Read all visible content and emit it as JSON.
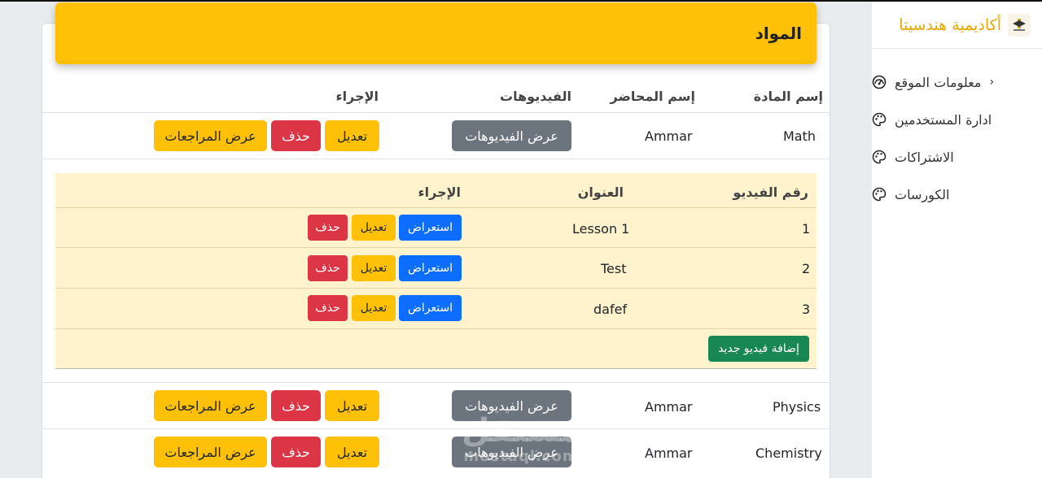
{
  "sidebar": {
    "brand": "أكاديمية هندسيتا",
    "items": [
      {
        "label": "معلومات الموقع",
        "icon": "gauge-icon",
        "has_chevron": true
      },
      {
        "label": "ادارة المستخدمين",
        "icon": "palette-icon"
      },
      {
        "label": "الاشتراكات",
        "icon": "palette-icon"
      },
      {
        "label": "الكورسات",
        "icon": "palette-icon"
      }
    ]
  },
  "card": {
    "title": "المواد",
    "headers": {
      "subject": "إسم المادة",
      "lecturer": "إسم المحاضر",
      "videos": "الفيديوهات",
      "action": "الإجراء"
    },
    "rows": [
      {
        "subject": "Math",
        "lecturer": "Ammar"
      },
      {
        "subject": "Physics",
        "lecturer": "Ammar"
      },
      {
        "subject": "Chemistry",
        "lecturer": "Ammar"
      }
    ],
    "buttons": {
      "view_videos": "عرض الفيديوهات",
      "edit": "تعديل",
      "delete": "حذف",
      "view_reviews": "عرض المراجعات"
    }
  },
  "videos": {
    "headers": {
      "number": "رقم الفيديو",
      "title": "العنوان",
      "action": "الإجراء"
    },
    "rows": [
      {
        "number": "1",
        "title": "Lesson 1"
      },
      {
        "number": "2",
        "title": "Test"
      },
      {
        "number": "3",
        "title": "dafef"
      }
    ],
    "buttons": {
      "view": "استعراض",
      "edit": "تعديل",
      "delete": "حذف",
      "add": "إضافة فيديو جديد"
    }
  },
  "watermark": {
    "line1": "مستقل",
    "line2": "mostaql.com"
  },
  "colors": {
    "accent": "#ffc107",
    "danger": "#dc3545",
    "primary": "#0d6efd",
    "secondary": "#6c757d",
    "success": "#198754",
    "panel": "#fff3cd"
  }
}
